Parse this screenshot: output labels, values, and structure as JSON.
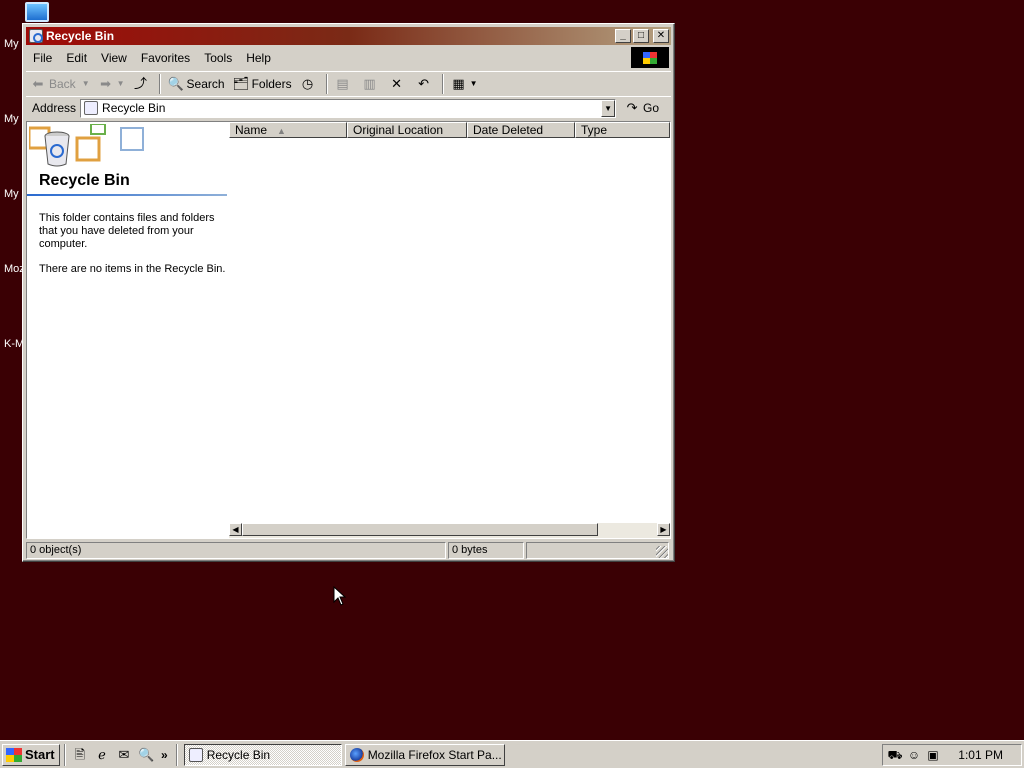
{
  "desktop": {
    "icon_labels": [
      "My",
      "My D",
      "My",
      "Moz",
      "K-M"
    ]
  },
  "window": {
    "title": "Recycle Bin",
    "buttons": {
      "minimize": "_",
      "maximize": "□",
      "close": "✕"
    },
    "menu": [
      "File",
      "Edit",
      "View",
      "Favorites",
      "Tools",
      "Help"
    ],
    "toolbar": {
      "back": "Back",
      "search": "Search",
      "folders": "Folders"
    },
    "address": {
      "label": "Address",
      "value": "Recycle Bin",
      "go": "Go"
    },
    "left_pane": {
      "title": "Recycle Bin",
      "description": "This folder contains files and folders that you have deleted from your computer.",
      "empty_message": "There are no items in the Recycle Bin."
    },
    "columns": [
      "Name",
      "Original Location",
      "Date Deleted",
      "Type"
    ],
    "status": {
      "objects": "0 object(s)",
      "size": "0 bytes"
    }
  },
  "taskbar": {
    "start": "Start",
    "tasks": [
      "Recycle Bin",
      "Mozilla Firefox Start Pa..."
    ],
    "clock": "1:01 PM"
  },
  "colors": {
    "desktop": "#3a0004",
    "titlebar_start": "#a00a08",
    "chrome": "#d4d0c8"
  }
}
